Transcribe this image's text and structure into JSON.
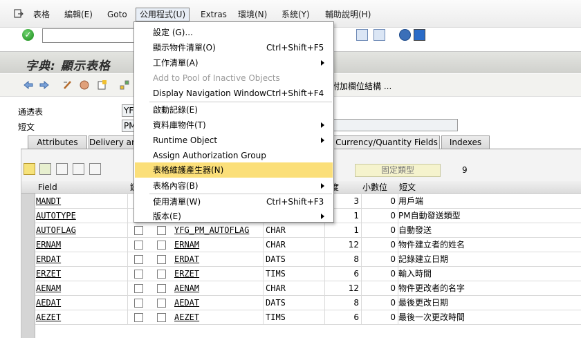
{
  "menubar": {
    "items": [
      {
        "label": "表格"
      },
      {
        "label": "編輯(E)"
      },
      {
        "label": "Goto"
      },
      {
        "label": "公用程式(U)"
      },
      {
        "label": "Extras"
      },
      {
        "label": "環境(N)"
      },
      {
        "label": "系統(Y)"
      },
      {
        "label": "輔助說明(H)"
      }
    ]
  },
  "title": "字典: 顯示表格",
  "apptoolbar": {
    "extra_label": "附加欄位結構 ..."
  },
  "form": {
    "table_label": "通透表",
    "table_value": "YFG",
    "short_label": "短文",
    "short_value": "PM"
  },
  "tabs": [
    {
      "label": "Attributes"
    },
    {
      "label": "Delivery and"
    },
    {
      "label": "Currency/Quantity Fields"
    },
    {
      "label": "Indexes"
    }
  ],
  "panel": {
    "fixed_type_label": "固定類型",
    "count": "9"
  },
  "grid": {
    "headers": {
      "field": "Field",
      "key": "鍵",
      "length": "度",
      "decimals": "小數位",
      "short_text": "短文"
    },
    "rows": [
      {
        "field": "MANDT",
        "length": "3",
        "decimals": "0",
        "text": "用戶端"
      },
      {
        "field": "AUTOTYPE",
        "length": "1",
        "decimals": "0",
        "text": "PM自動發送類型"
      },
      {
        "field": "AUTOFLAG",
        "de": "YFG_PM_AUTOFLAG",
        "dtype": "CHAR",
        "length": "1",
        "decimals": "0",
        "text": "自動發送"
      },
      {
        "field": "ERNAM",
        "de": "ERNAM",
        "dtype": "CHAR",
        "length": "12",
        "decimals": "0",
        "text": "物件建立者的姓名"
      },
      {
        "field": "ERDAT",
        "de": "ERDAT",
        "dtype": "DATS",
        "length": "8",
        "decimals": "0",
        "text": "記錄建立日期"
      },
      {
        "field": "ERZET",
        "de": "ERZET",
        "dtype": "TIMS",
        "length": "6",
        "decimals": "0",
        "text": "輸入時間"
      },
      {
        "field": "AENAM",
        "de": "AENAM",
        "dtype": "CHAR",
        "length": "12",
        "decimals": "0",
        "text": "物件更改者的名字"
      },
      {
        "field": "AEDAT",
        "de": "AEDAT",
        "dtype": "DATS",
        "length": "8",
        "decimals": "0",
        "text": "最後更改日期"
      },
      {
        "field": "AEZET",
        "de": "AEZET",
        "dtype": "TIMS",
        "length": "6",
        "decimals": "0",
        "text": "最後一次更改時間"
      }
    ]
  },
  "dropdown": {
    "items": [
      {
        "label": "設定 (G)...",
        "shortcut": ""
      },
      {
        "label": "顯示物件清單(O)",
        "shortcut": "Ctrl+Shift+F5"
      },
      {
        "label": "工作清單(A)",
        "shortcut": ""
      },
      {
        "label": "Add to Pool of Inactive Objects",
        "shortcut": ""
      },
      {
        "label": "Display Navigation Window",
        "shortcut": "Ctrl+Shift+F4"
      },
      {
        "label": "啟動記錄(E)",
        "shortcut": ""
      },
      {
        "label": "資料庫物件(T)",
        "shortcut": ""
      },
      {
        "label": "Runtime Object",
        "shortcut": ""
      },
      {
        "label": "Assign Authorization Group",
        "shortcut": ""
      },
      {
        "label": "表格維護產生器(N)",
        "shortcut": ""
      },
      {
        "label": "表格內容(B)",
        "shortcut": ""
      },
      {
        "label": "使用清單(W)",
        "shortcut": "Ctrl+Shift+F3"
      },
      {
        "label": "版本(E)",
        "shortcut": ""
      }
    ]
  },
  "colors": {
    "highlight": "#fbdf79",
    "title_bg": "#d0d1cd"
  }
}
